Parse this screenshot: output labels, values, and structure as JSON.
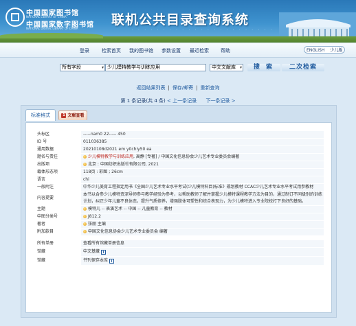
{
  "header": {
    "library_name_1": "中国国家图书馆",
    "library_name_1_en": "NATIONAL LIBRARY OF CHINA",
    "library_name_2": "中国国家数字图书馆",
    "library_name_2_en": "NATIONAL DIGITAL LIBRARY OF CHINA",
    "system_title": "联机公共目录查询系统",
    "decoration": ". . . . . . . . . . . . . . . . . . . . . . ."
  },
  "nav": {
    "items": [
      "登录",
      "检索首页",
      "我的图书馆",
      "参数设置",
      "最近检索",
      "帮助"
    ],
    "lang_en": "ENGLISH",
    "lang_kid": "少儿版"
  },
  "search": {
    "field": "所有字段",
    "query": "少儿模特教学与训练应用",
    "database": "中文文献库",
    "search_button": "搜 索",
    "advanced_button": "二次检索"
  },
  "result_links": [
    "返回结果列表",
    "保存/邮寄",
    "重新查询"
  ],
  "record_nav": {
    "status": "第 1 条记录(共 4 条)",
    "prev": "< 上一条记录",
    "next": "下一条记录 >"
  },
  "tabs": {
    "standard": "标准格式",
    "other": "文献查看",
    "other_badge": "1"
  },
  "record": {
    "header_label": "头标区",
    "header_value": "-----nam0 22----- 450",
    "id_label": "ID 号",
    "id_value": "011036385",
    "general_label": "通用数据",
    "general_value": "20210108d2021 em y0chiy50 ea",
    "title_label": "题名与责任",
    "title_link": "少儿模特教学与训练应用",
    "title_rest": ", 高静 [专著] / 中国文化信息协会少儿艺术专业委员会编著",
    "publish_label": "出版项",
    "publish_value": "北京 : 中国纺织出版社有限公司, 2021",
    "form_label": "载体形态项",
    "form_value": "118页 : 彩图 ; 26cm",
    "lang_label": "语言",
    "lang_value": "chi",
    "note_label": "一般附注",
    "note_value": "中华少儿美育工程指定用书《全国少儿艺术专业水平考试(少儿模特科目)标准》规划教材 CCAC少儿艺术专业水平考试用参教材",
    "summary_label": "内容提要",
    "summary_value": "本书以合参少儿模特资深导师参与教学经验为参考，以帮助教师了解并掌握少儿模特课程教学方法为目的，通过制订不同级别的训练计划，纠正少年儿童不良体态，提升气质修养，增强肢体可塑性和综合表现力，为少儿模特进入专业院校打下良好的基础。",
    "subject_label": "主题",
    "subject_value": "模特儿 -- 表演艺术 -- 中国 -- 儿童教育 -- 教材",
    "class_label": "中图分类号",
    "class_value": "J812.2",
    "author_label": "著者",
    "author_value": "张丽 主编",
    "addl_label": "附加款目",
    "addl_value": "中国文化信息协会少儿艺术专业委员会 编著",
    "all_label": "所有单册",
    "all_value": "查看所有馆藏单册信息",
    "hold1_label": "馆藏",
    "hold1_value": "中文基藏",
    "hold2_label": "馆藏",
    "hold2_value": "书刊保存本库"
  },
  "colors": {
    "banner": "#2a78b8",
    "link": "#1f5a9e",
    "title_highlight": "#c0281f",
    "panel": "#cfe0ef"
  }
}
